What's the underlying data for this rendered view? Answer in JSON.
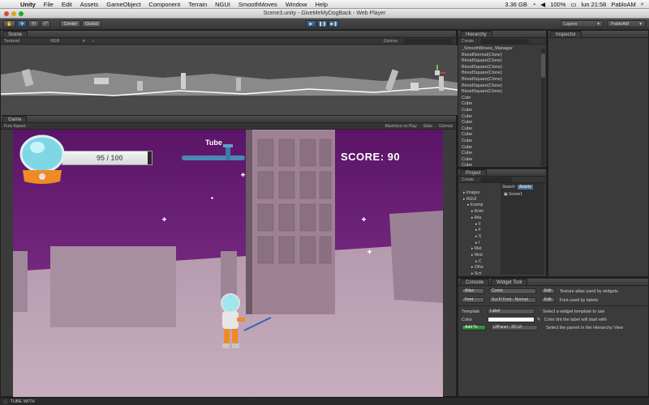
{
  "menubar": {
    "app": "Unity",
    "items": [
      "File",
      "Edit",
      "Assets",
      "GameObject",
      "Component",
      "Terrain",
      "NGUI",
      "SmoothMoves",
      "Window",
      "Help"
    ],
    "status": {
      "battery_label": "3.36 GB",
      "battery_percent": "100%",
      "clock": "lun 21:58",
      "user": "PabloAM"
    }
  },
  "window": {
    "title": "Scene3.unity - GiveMeMyDogBack - Web Player"
  },
  "toolbar": {
    "tools": [
      "hand",
      "move",
      "rotate",
      "scale"
    ],
    "pivot_label": "Center",
    "space_label": "Global",
    "layers_label": "Layers",
    "layout_label": "PabloAM"
  },
  "scene": {
    "tab": "Scene",
    "shading": "Textured",
    "render": "RGB",
    "gizmos": "Gizmos",
    "search_placeholder": "All"
  },
  "hierarchy": {
    "tab": "Hierarchy",
    "create_label": "Create",
    "items": [
      "_SmoothMoves_Manager",
      "BloodNormal(Clone)",
      "BloodSquare(Clone)",
      "BloodSquare(Clone)",
      "BloodSquare(Clone)",
      "BloodSquare(Clone)",
      "BloodSquare(Clone)",
      "BloodSquare(Clone)",
      "Coin",
      "Cube",
      "Cube",
      "Cube",
      "Cube",
      "Cube",
      "Cube",
      "Cube",
      "Cube",
      "Cube",
      "Cube",
      "Cube",
      "Cube"
    ]
  },
  "inspector": {
    "tab": "Inspector"
  },
  "project": {
    "tab": "Project",
    "create_label": "Create",
    "search_placeholder": "Search",
    "assets_button": "Assets",
    "tree": [
      "Images",
      "NGUI",
      "Examp",
      "Anim",
      "Atla",
      "F",
      "F",
      "S",
      "I",
      "Mat",
      "Mod",
      "C",
      "Othe",
      "Scri",
      "Scr"
    ],
    "assets": [
      "Scene1"
    ]
  },
  "game": {
    "tab": "Game",
    "aspect": "Free Aspect",
    "maximize_label": "Maximize on Play",
    "stats_label": "Stats",
    "gizmos_label": "Gizmos",
    "hud": {
      "health_text": "95 / 100",
      "health_fraction": 0.95,
      "tube_label": "Tube",
      "score_text": "SCORE: 90"
    }
  },
  "console": {
    "tab": "Console",
    "tab2": "Widget Tool"
  },
  "widget_tool": {
    "atlas_label": "Atlas",
    "atlas_value": "Comic",
    "atlas_edit": "Edit",
    "atlas_desc": "Texture atlas used by widgets",
    "font_label": "Font",
    "font_value": "Sci-Fi Font - Normal",
    "font_edit": "Edit",
    "font_desc": "Font used by labels",
    "template_label": "Template",
    "template_value": "Label",
    "template_desc": "Select a widget template to use",
    "color_label": "Color",
    "color_value": "#ffffff",
    "color_desc": "Color tint the label will start with",
    "add_label": "Add To",
    "parent_value": "UIPanel - 2D UI",
    "parent_desc": "Select the parent in the Hierarchy View"
  },
  "status": {
    "message": "TUBE WITH"
  },
  "colors": {
    "sky": "#6b1f79",
    "ground": "#b197a9",
    "accent_blue": "#3d6a9a",
    "add_green": "#2e7d32"
  }
}
